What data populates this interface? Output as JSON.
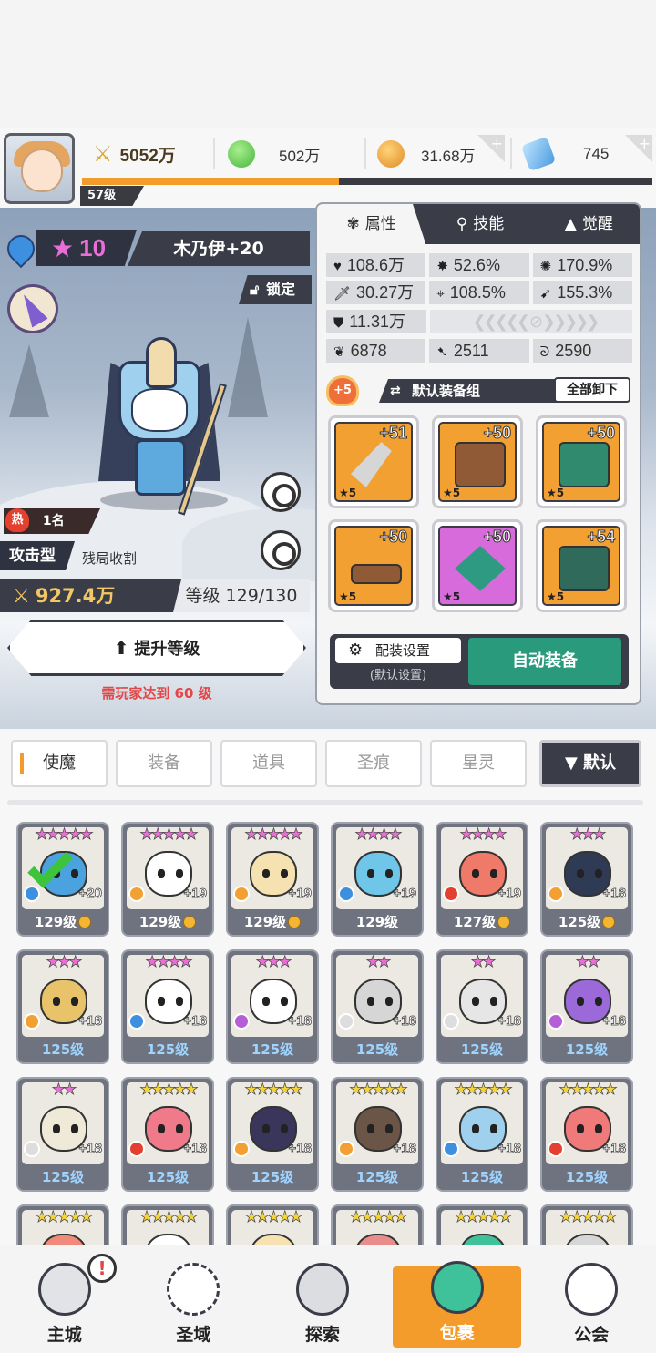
{
  "player": {
    "level": "57级"
  },
  "resources": {
    "power": "5052万",
    "green_gem": "502万",
    "gold": "31.68万",
    "diamond": "745"
  },
  "hero": {
    "stars": "10",
    "name": "木乃伊+20",
    "lock": "锁定",
    "hot_rank": "1名",
    "hot_icon": "热",
    "type": "攻击型",
    "type_desc": "残局收割",
    "power": "927.4万",
    "level": "等级 129/130",
    "upgrade": "提升等级",
    "upgrade_note": "需玩家达到 60 级"
  },
  "panel": {
    "tabs": [
      "属性",
      "技能",
      "觉醒"
    ],
    "stats": {
      "hp": "108.6万",
      "crit": "52.6%",
      "crit_dmg": "170.9%",
      "atk": "30.27万",
      "accuracy": "108.5%",
      "speed": "155.3%",
      "def": "11.31万",
      "s1": "6878",
      "s2": "2511",
      "s3": "2590"
    },
    "set_badge": "+5",
    "set_name": "默认装备组",
    "unequip_all": "全部卸下",
    "gear": [
      {
        "plus": "+51",
        "stars": "★5",
        "rarity": "orange"
      },
      {
        "plus": "+50",
        "stars": "★5",
        "rarity": "orange"
      },
      {
        "plus": "+50",
        "stars": "★5",
        "rarity": "orange"
      },
      {
        "plus": "+50",
        "stars": "★5",
        "rarity": "orange"
      },
      {
        "plus": "+50",
        "stars": "★5",
        "rarity": "purple"
      },
      {
        "plus": "+54",
        "stars": "★5",
        "rarity": "orange"
      }
    ],
    "config": "配装设置",
    "config_sub": "(默认设置)",
    "auto_equip": "自动装备"
  },
  "inventory": {
    "tabs": [
      "使魔",
      "装备",
      "道具",
      "圣痕",
      "星灵"
    ],
    "sort": "▼ 默认",
    "cards": [
      {
        "stars": "★★★★★",
        "star_color": "#e96ed6",
        "plus": "+20",
        "level": "129级",
        "coin": true,
        "elem": "#3d8fe0",
        "tone": "#4aa3df",
        "checked": true
      },
      {
        "stars": "★★★★★",
        "star_color": "#e96ed6",
        "plus": "+19",
        "level": "129级",
        "coin": true,
        "elem": "#f3a032",
        "tone": "#ffffff"
      },
      {
        "stars": "★★★★★",
        "star_color": "#e96ed6",
        "plus": "+19",
        "level": "129级",
        "coin": true,
        "elem": "#f3a032",
        "tone": "#f6e2b0"
      },
      {
        "stars": "★★★★",
        "star_color": "#e96ed6",
        "plus": "+19",
        "level": "129级",
        "coin": false,
        "elem": "#3d8fe0",
        "tone": "#6fc6e8"
      },
      {
        "stars": "★★★★",
        "star_color": "#e96ed6",
        "plus": "+19",
        "level": "127级",
        "coin": true,
        "elem": "#e3402f",
        "tone": "#f07a6a"
      },
      {
        "stars": "★★★",
        "star_color": "#e96ed6",
        "plus": "+18",
        "level": "125级",
        "coin": true,
        "elem": "#f3a032",
        "tone": "#2f3a55"
      },
      {
        "stars": "★★★",
        "star_color": "#e96ed6",
        "plus": "+18",
        "level": "125级",
        "blue": true,
        "elem": "#f3a032",
        "tone": "#e8c36a"
      },
      {
        "stars": "★★★★",
        "star_color": "#e96ed6",
        "plus": "+18",
        "level": "125级",
        "blue": true,
        "elem": "#3d8fe0",
        "tone": "#ffffff"
      },
      {
        "stars": "★★★",
        "star_color": "#e96ed6",
        "plus": "+18",
        "level": "125级",
        "blue": true,
        "elem": "#b45fd6",
        "tone": "#ffffff"
      },
      {
        "stars": "★★",
        "star_color": "#e96ed6",
        "plus": "+18",
        "level": "125级",
        "blue": true,
        "elem": "#dddddd",
        "tone": "#d6d6d6"
      },
      {
        "stars": "★★",
        "star_color": "#e96ed6",
        "plus": "+18",
        "level": "125级",
        "blue": true,
        "elem": "#dddddd",
        "tone": "#e6e6e6"
      },
      {
        "stars": "★★",
        "star_color": "#e96ed6",
        "plus": "+18",
        "level": "125级",
        "blue": true,
        "elem": "#b45fd6",
        "tone": "#9b6ad8"
      },
      {
        "stars": "★★",
        "star_color": "#e96ed6",
        "plus": "+18",
        "level": "125级",
        "blue": true,
        "elem": "#dddddd",
        "tone": "#efe9d8"
      },
      {
        "stars": "★★★★★",
        "star_color": "#f3d23a",
        "plus": "+18",
        "level": "125级",
        "blue": true,
        "elem": "#e3402f",
        "tone": "#f07a8a"
      },
      {
        "stars": "★★★★★",
        "star_color": "#f3d23a",
        "plus": "+18",
        "level": "125级",
        "blue": true,
        "elem": "#f3a032",
        "tone": "#3a355a"
      },
      {
        "stars": "★★★★★",
        "star_color": "#f3d23a",
        "plus": "+18",
        "level": "125级",
        "blue": true,
        "elem": "#f3a032",
        "tone": "#6b5546"
      },
      {
        "stars": "★★★★★",
        "star_color": "#f3d23a",
        "plus": "+18",
        "level": "125级",
        "blue": true,
        "elem": "#3d8fe0",
        "tone": "#9fd0ee"
      },
      {
        "stars": "★★★★★",
        "star_color": "#f3d23a",
        "plus": "+18",
        "level": "125级",
        "blue": true,
        "elem": "#e3402f",
        "tone": "#f07a7a"
      },
      {
        "stars": "★★★★★",
        "star_color": "#f3d23a",
        "plus": "",
        "level": "",
        "elem": "",
        "tone": "#f08a7a"
      },
      {
        "stars": "★★★★★",
        "star_color": "#f3d23a",
        "plus": "",
        "level": "",
        "elem": "",
        "tone": "#ffffff"
      },
      {
        "stars": "★★★★★",
        "star_color": "#f3d23a",
        "plus": "",
        "level": "",
        "elem": "",
        "tone": "#f6e2b0"
      },
      {
        "stars": "★★★★★",
        "star_color": "#f3d23a",
        "plus": "",
        "level": "",
        "elem": "",
        "tone": "#e88c8c"
      },
      {
        "stars": "★★★★★",
        "star_color": "#f3d23a",
        "plus": "",
        "level": "",
        "elem": "",
        "tone": "#3fc29a"
      },
      {
        "stars": "★★★★★",
        "star_color": "#f3d23a",
        "plus": "",
        "level": "",
        "elem": "",
        "tone": "#d6d6d6"
      }
    ]
  },
  "nav": {
    "items": [
      "主城",
      "圣域",
      "探索",
      "包裹",
      "公会"
    ],
    "alert": "!"
  },
  "colors": {
    "accent": "#f39b2b",
    "dark": "#3a3d47",
    "teal": "#2a9a7d",
    "pink": "#e96ed6"
  }
}
